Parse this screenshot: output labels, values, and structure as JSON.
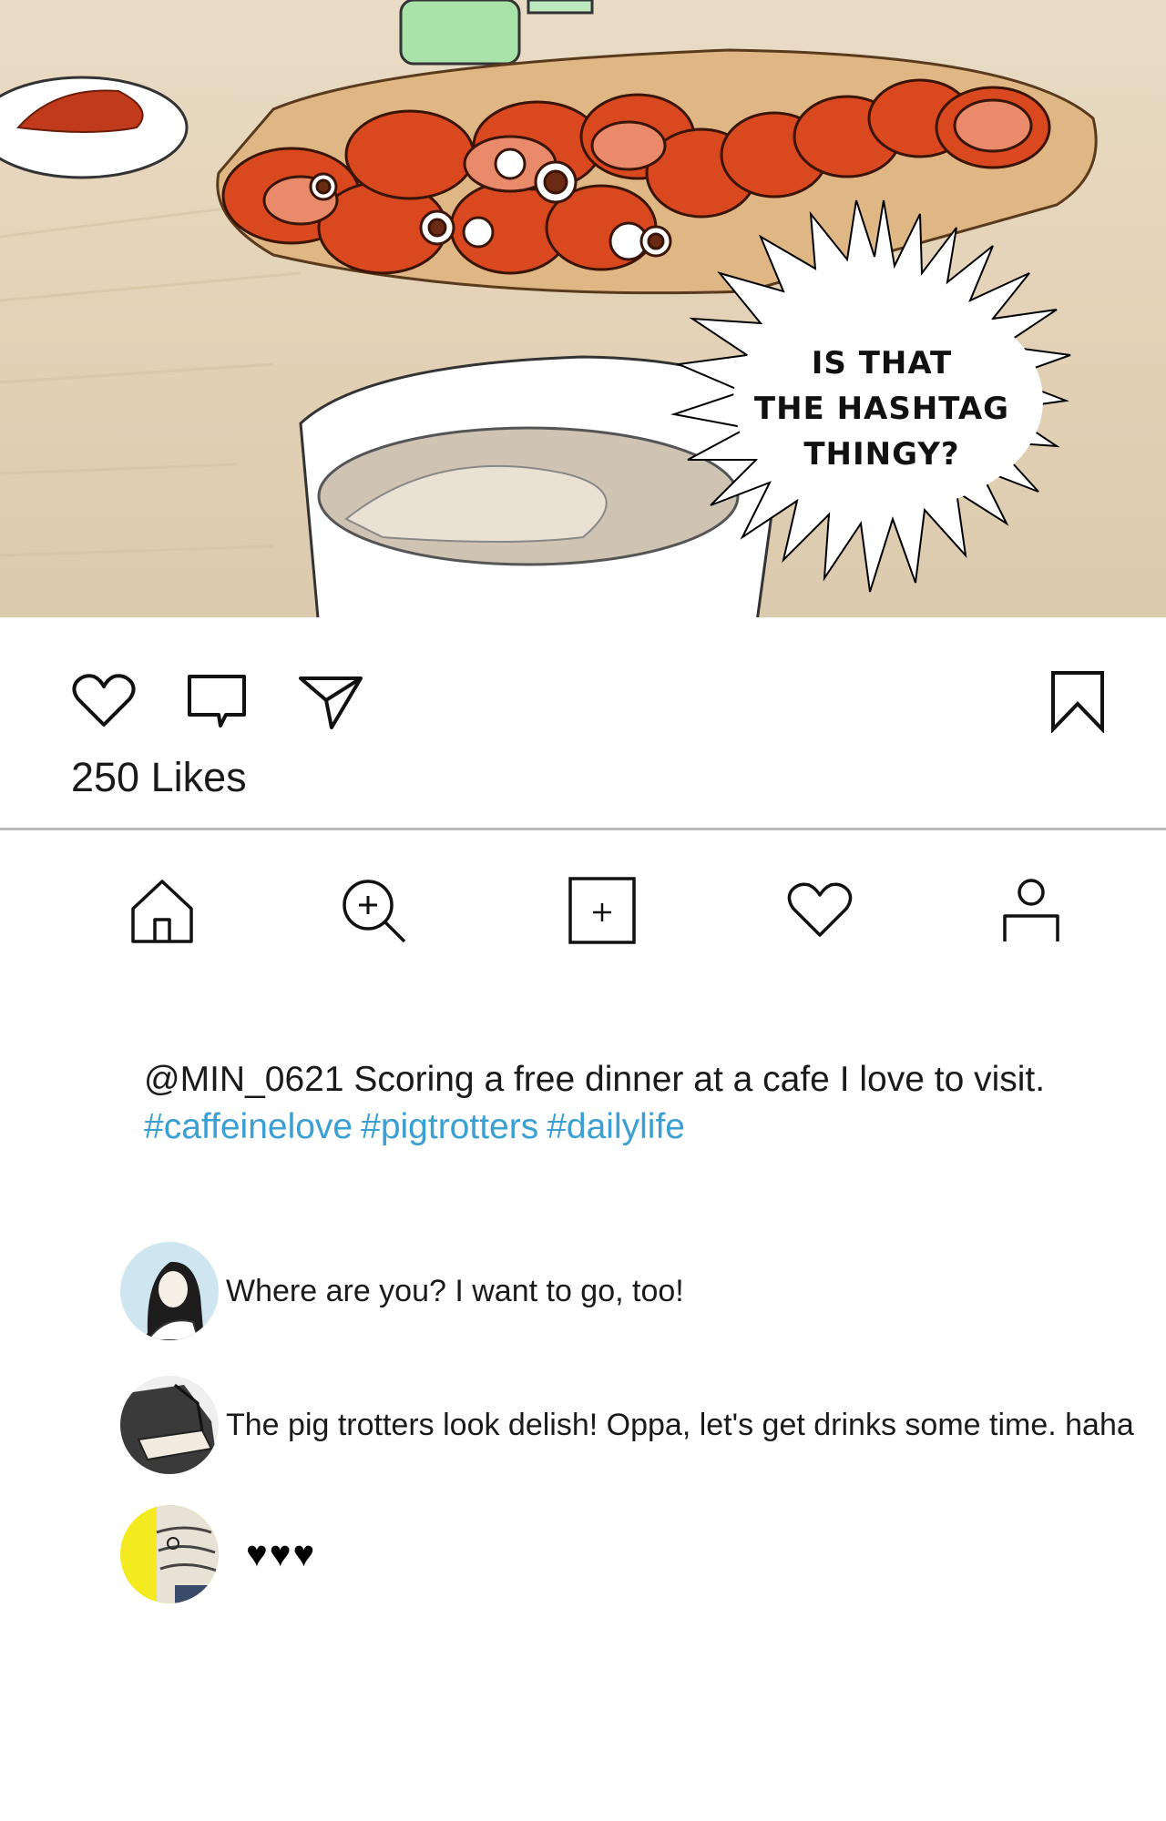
{
  "post": {
    "speech_bubble": [
      "IS THAT",
      "THE HASHTAG",
      "THINGY?"
    ],
    "likes_label": "250 Likes",
    "caption": {
      "username": "@MIN_0621",
      "text": "Scoring a free dinner at a cafe I love to visit.",
      "hashtags": [
        "#caffeinelove",
        "#pigtrotters",
        "#dailylife"
      ]
    }
  },
  "actions": {
    "icons": [
      "heart-outline-icon",
      "comment-icon",
      "send-icon",
      "bookmark-icon"
    ]
  },
  "nav": {
    "icons": [
      "home-icon",
      "search-icon",
      "add-post-icon",
      "activity-heart-icon",
      "profile-icon"
    ]
  },
  "comments": [
    {
      "text": "Where are you? I want to go, too!",
      "avatar_color": "#cfe6f0"
    },
    {
      "text": "The pig trotters look delish! Oppa, let's get drinks some time. haha",
      "avatar_color": "#3a3a3a"
    },
    {
      "text": "♥♥♥",
      "avatar_color": "#f3ea1f"
    }
  ],
  "colors": {
    "hashtag": "#3a9fd3",
    "divider": "#b9b9b9",
    "food_sauce": "#d9481e"
  }
}
